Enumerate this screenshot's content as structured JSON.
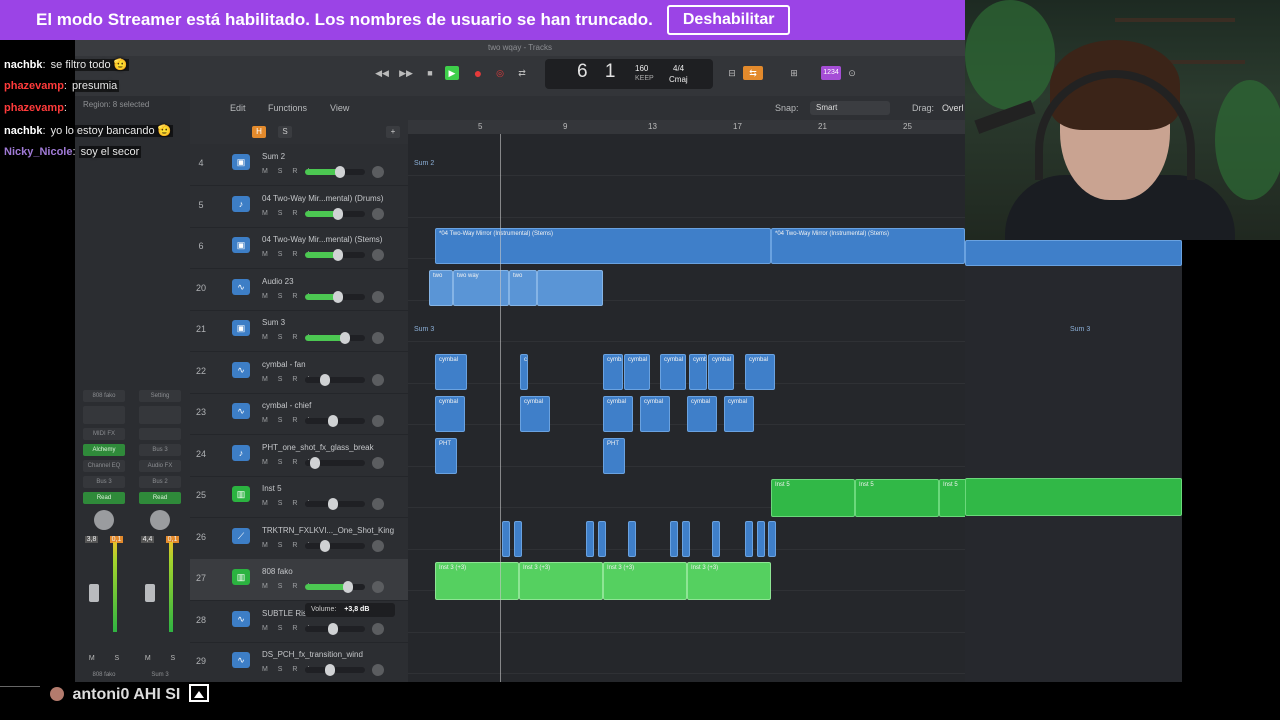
{
  "banner": {
    "text": "El modo Streamer está habilitado. Los nombres de usuario se han truncado.",
    "button_label": "Deshabilitar",
    "color": "#9b44e6"
  },
  "daw": {
    "window_title": "two wqay - Tracks",
    "lcd": {
      "position": "6  1",
      "tempo": "160",
      "tempo_label": "KEEP",
      "signature": "4/4",
      "key": "Cmaj"
    },
    "toolbar": {
      "edit": "Edit",
      "functions": "Functions",
      "view": "View",
      "snap_label": "Snap:",
      "snap_value": "Smart",
      "drag_label": "Drag:",
      "drag_value": "Overl"
    },
    "inspector": {
      "region_label": "Region: 8 selected",
      "strips": [
        {
          "name": "808 fako",
          "setting": "808 fako",
          "eq": "MIDI FX",
          "instrument": "Alchemy",
          "channel_eq": "Channel EQ",
          "send": "Bus 3",
          "read": "Read",
          "val1": "3,8",
          "val2": "0,1"
        },
        {
          "name": "Sum 3",
          "setting": "Setting",
          "eq": "",
          "instrument": "Bus 3",
          "channel_eq": "Audio FX",
          "send": "Bus 2",
          "read": "Read",
          "val1": "4,4",
          "val2": "0,1"
        }
      ],
      "strip_buttons": [
        "M",
        "S"
      ]
    },
    "header_buttons": {
      "h": "H",
      "s": "S"
    },
    "ruler_marks": [
      "5",
      "9",
      "13",
      "17",
      "21",
      "25"
    ],
    "tracks": [
      {
        "num": "4",
        "name": "Sum 2",
        "icon": "folder-icon",
        "vol": 0.6
      },
      {
        "num": "5",
        "name": "04 Two-Way Mir...mental) (Drums)",
        "icon": "drum-icon",
        "vol": 0.55
      },
      {
        "num": "6",
        "name": "04 Two-Way Mir...mental) (Stems)",
        "icon": "folder-icon",
        "vol": 0.55
      },
      {
        "num": "20",
        "name": "Audio 23",
        "icon": "waveform-icon",
        "vol": 0.55
      },
      {
        "num": "21",
        "name": "Sum 3",
        "icon": "folder-icon",
        "vol": 0.7
      },
      {
        "num": "22",
        "name": "cymbal - fan",
        "icon": "waveform-icon",
        "vol": 0.3
      },
      {
        "num": "23",
        "name": "cymbal - chief",
        "icon": "waveform-icon",
        "vol": 0.45
      },
      {
        "num": "24",
        "name": "PHT_one_shot_fx_glass_break",
        "icon": "drum-icon",
        "vol": 0.1
      },
      {
        "num": "25",
        "name": "Inst 5",
        "icon": "synth-icon",
        "vol": 0.45
      },
      {
        "num": "26",
        "name": "TRKTRN_FXLKVI..._One_Shot_King",
        "icon": "guitar-icon",
        "vol": 0.3
      },
      {
        "num": "27",
        "name": "808 fako",
        "icon": "synth-icon",
        "vol": 0.75
      },
      {
        "num": "28",
        "name": "SUBTLE Rise",
        "icon": "waveform-icon",
        "vol": 0.45
      },
      {
        "num": "29",
        "name": "DS_PCH_fx_transition_wind",
        "icon": "waveform-icon",
        "vol": 0.4
      }
    ],
    "msr_text": "M S R I",
    "tooltip": {
      "label": "Volume:",
      "value": "+3,8 dB"
    },
    "regions": {
      "sum2_label": "Sum 2",
      "stems1": "*04 Two-Way Mirror (Instrumental) (Stems)",
      "stems2": "*04 Two-Way Mirror (Instrumental) (Stems)",
      "audio_a": "two",
      "audio_b": "two way",
      "audio_c": "two",
      "sum3_label": "Sum 3",
      "sum3_label_right": "Sum 3",
      "cymbal": "cymbal",
      "pht": "PHT",
      "inst5": "Inst 5",
      "inst3": "Inst 3 (+3)"
    }
  },
  "chat": [
    {
      "user": "nachbk",
      "text": "se filtro todo 🫡",
      "color": "#ffffff"
    },
    {
      "user": "phazevamp",
      "text": "presumia",
      "color": "#ff3b3b"
    },
    {
      "user": "phazevamp",
      "text": "",
      "color": "#ff3b3b"
    },
    {
      "user": "nachbk",
      "text": "yo lo estoy bancando 🫡",
      "color": "#ffffff"
    },
    {
      "user": "Nicky_Nicole",
      "text": "soy el secor",
      "color": "#a07ad6"
    }
  ],
  "bottom_chat": {
    "user": "antoni0",
    "text": "AHI SI"
  }
}
